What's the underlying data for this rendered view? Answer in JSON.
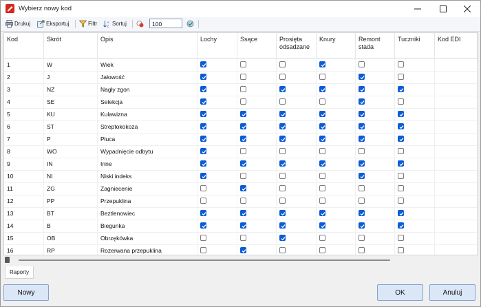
{
  "window": {
    "title": "Wybierz nowy kod"
  },
  "toolbar": {
    "print_label": "Drukuj",
    "export_label": "Eksportuj",
    "filter_label": "Filtr",
    "sort_label": "Sortuj",
    "limit_value": "100"
  },
  "table": {
    "columns": [
      "Kod",
      "Skrót",
      "Opis",
      "Lochy",
      "Ssące",
      "Prosięta odsadzane",
      "Knury",
      "Remont stada",
      "Tuczniki",
      "Kod EDI"
    ],
    "rows": [
      {
        "kod": "1",
        "skrot": "W",
        "opis": "Wiek",
        "flags": [
          1,
          0,
          0,
          1,
          0,
          0
        ]
      },
      {
        "kod": "2",
        "skrot": "J",
        "opis": "Jałowość",
        "flags": [
          1,
          0,
          0,
          0,
          1,
          0
        ]
      },
      {
        "kod": "3",
        "skrot": "NZ",
        "opis": "Nagły zgon",
        "flags": [
          1,
          0,
          1,
          1,
          1,
          1
        ]
      },
      {
        "kod": "4",
        "skrot": "SE",
        "opis": "Selekcja",
        "flags": [
          1,
          0,
          0,
          0,
          1,
          0
        ]
      },
      {
        "kod": "5",
        "skrot": "KU",
        "opis": "Kulawizna",
        "flags": [
          1,
          1,
          1,
          1,
          1,
          1
        ]
      },
      {
        "kod": "6",
        "skrot": "ST",
        "opis": "Streptokokoza",
        "flags": [
          1,
          1,
          1,
          1,
          1,
          1
        ]
      },
      {
        "kod": "7",
        "skrot": "P",
        "opis": "Płuca",
        "flags": [
          1,
          1,
          1,
          1,
          1,
          1
        ]
      },
      {
        "kod": "8",
        "skrot": "WO",
        "opis": "Wypadnięcie odbytu",
        "flags": [
          1,
          0,
          0,
          0,
          0,
          0
        ]
      },
      {
        "kod": "9",
        "skrot": "IN",
        "opis": "Inne",
        "flags": [
          1,
          1,
          1,
          1,
          1,
          1
        ]
      },
      {
        "kod": "10",
        "skrot": "NI",
        "opis": "Niski indeks",
        "flags": [
          1,
          0,
          0,
          0,
          1,
          0
        ]
      },
      {
        "kod": "11",
        "skrot": "ZG",
        "opis": "Zagniecenie",
        "flags": [
          0,
          1,
          0,
          0,
          0,
          0
        ]
      },
      {
        "kod": "12",
        "skrot": "PP",
        "opis": "Przepuklina",
        "flags": [
          0,
          0,
          0,
          0,
          0,
          0
        ]
      },
      {
        "kod": "13",
        "skrot": "BT",
        "opis": "Beztlenowiec",
        "flags": [
          1,
          1,
          1,
          1,
          1,
          1
        ]
      },
      {
        "kod": "14",
        "skrot": "B",
        "opis": "Biegunka",
        "flags": [
          1,
          1,
          1,
          1,
          1,
          1
        ]
      },
      {
        "kod": "15",
        "skrot": "OB",
        "opis": "Obrzękówka",
        "flags": [
          0,
          0,
          1,
          0,
          0,
          0
        ]
      },
      {
        "kod": "16",
        "skrot": "RP",
        "opis": "Rozerwana przepuklina",
        "flags": [
          0,
          1,
          0,
          0,
          0,
          0
        ]
      }
    ]
  },
  "tabs": {
    "reports_label": "Raporty"
  },
  "footer": {
    "new_label": "Nowy",
    "ok_label": "OK",
    "cancel_label": "Anuluj"
  },
  "colors": {
    "accent": "#0b5cd5",
    "button_bg": "#dbe7f6",
    "app_icon": "#d8261c"
  },
  "icons": [
    "app-icon",
    "print-icon",
    "export-icon",
    "filter-icon",
    "sort-icon",
    "clear-icon",
    "apply-icon",
    "minimize-icon",
    "maximize-icon",
    "close-icon"
  ]
}
